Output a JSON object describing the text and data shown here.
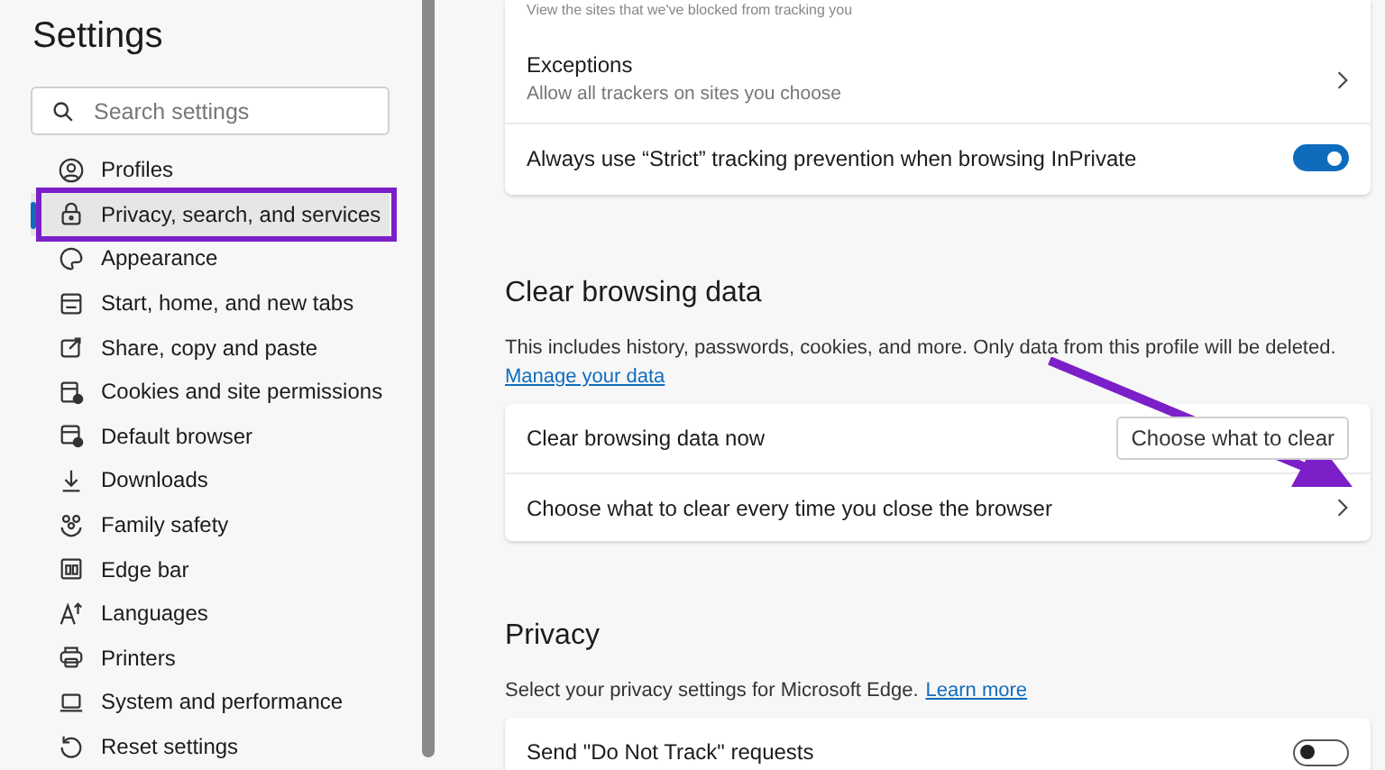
{
  "sidebar": {
    "title": "Settings",
    "search": {
      "placeholder": "Search settings"
    },
    "items": [
      {
        "label": "Profiles",
        "selected": false
      },
      {
        "label": "Privacy, search, and services",
        "selected": true
      },
      {
        "label": "Appearance",
        "selected": false
      },
      {
        "label": "Start, home, and new tabs",
        "selected": false
      },
      {
        "label": "Share, copy and paste",
        "selected": false
      },
      {
        "label": "Cookies and site permissions",
        "selected": false
      },
      {
        "label": "Default browser",
        "selected": false
      },
      {
        "label": "Downloads",
        "selected": false
      },
      {
        "label": "Family safety",
        "selected": false
      },
      {
        "label": "Edge bar",
        "selected": false
      },
      {
        "label": "Languages",
        "selected": false
      },
      {
        "label": "Printers",
        "selected": false
      },
      {
        "label": "System and performance",
        "selected": false
      },
      {
        "label": "Reset settings",
        "selected": false
      }
    ]
  },
  "tracking_card": {
    "cut_text": "View the sites that we've blocked from tracking you",
    "rows": [
      {
        "kind": "link",
        "title": "Exceptions",
        "subtitle": "Allow all trackers on sites you choose"
      },
      {
        "kind": "toggle",
        "title": "Always use “Strict” tracking prevention when browsing InPrivate",
        "on": true
      }
    ]
  },
  "clear_section": {
    "heading": "Clear browsing data",
    "description": "This includes history, passwords, cookies, and more. Only data from this profile will be deleted.",
    "link": "Manage your data",
    "rows": [
      {
        "kind": "button",
        "title": "Clear browsing data now",
        "button": "Choose what to clear"
      },
      {
        "kind": "link",
        "title": "Choose what to clear every time you close the browser"
      }
    ]
  },
  "privacy_section": {
    "heading": "Privacy",
    "description": "Select your privacy settings for Microsoft Edge.",
    "link": "Learn more",
    "rows": [
      {
        "kind": "toggle",
        "title": "Send \"Do Not Track\" requests",
        "on": false
      }
    ]
  }
}
